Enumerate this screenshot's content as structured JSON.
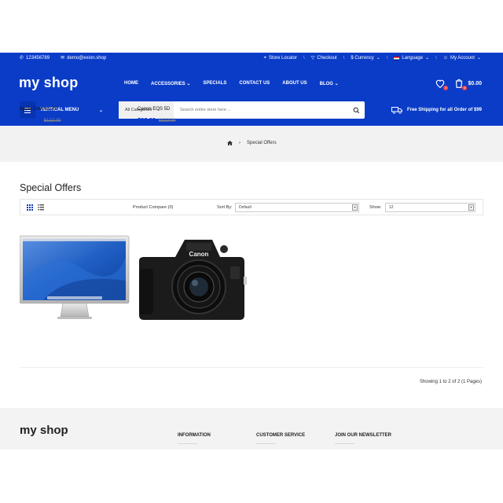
{
  "topbar": {
    "phone": "123456789",
    "email": "demo@exion.shop",
    "store_locator": "Store Locator",
    "checkout": "Checkout",
    "currency": "$ Currency",
    "language": "Language",
    "account": "My Account"
  },
  "header": {
    "logo": "my shop",
    "nav": [
      "HOME",
      "ACCESSORIES",
      "SPECIALS",
      "CONTACT US",
      "ABOUT US",
      "BLOG"
    ],
    "wishlist_count": "0",
    "cart_count": "0",
    "cart_total": "$0.00",
    "vertical_menu": "VERTICAL MENU",
    "search": {
      "category": "All Categories",
      "placeholder": "Search entire store here ..."
    },
    "shipping": "Free Shipping for all Order of $99"
  },
  "breadcrumb": {
    "current": "Special Offers"
  },
  "page": {
    "title": "Special Offers",
    "compare": "Product Compare (0)",
    "sort_label": "Sort By:",
    "sort_value": "Default",
    "show_label": "Show:",
    "show_value": "12",
    "showing": "Showing 1 to 2 of 2 (1 Pages)"
  },
  "products": [
    {
      "name": "Apple Cinema 30\"",
      "price": "$110.00",
      "old_price": "$122.00"
    },
    {
      "name": "Canon EOS 5D",
      "price": "$98.00",
      "old_price": "$122.00"
    }
  ],
  "footer": {
    "logo": "my shop",
    "information": "INFORMATION",
    "customer_service": "CUSTOMER SERVICE",
    "newsletter": "JOIN OUR NEWSLETTER"
  },
  "colors": {
    "brand": "#0a3cc8",
    "price": "#0a3cc8",
    "badge": "#ff3b3b"
  }
}
